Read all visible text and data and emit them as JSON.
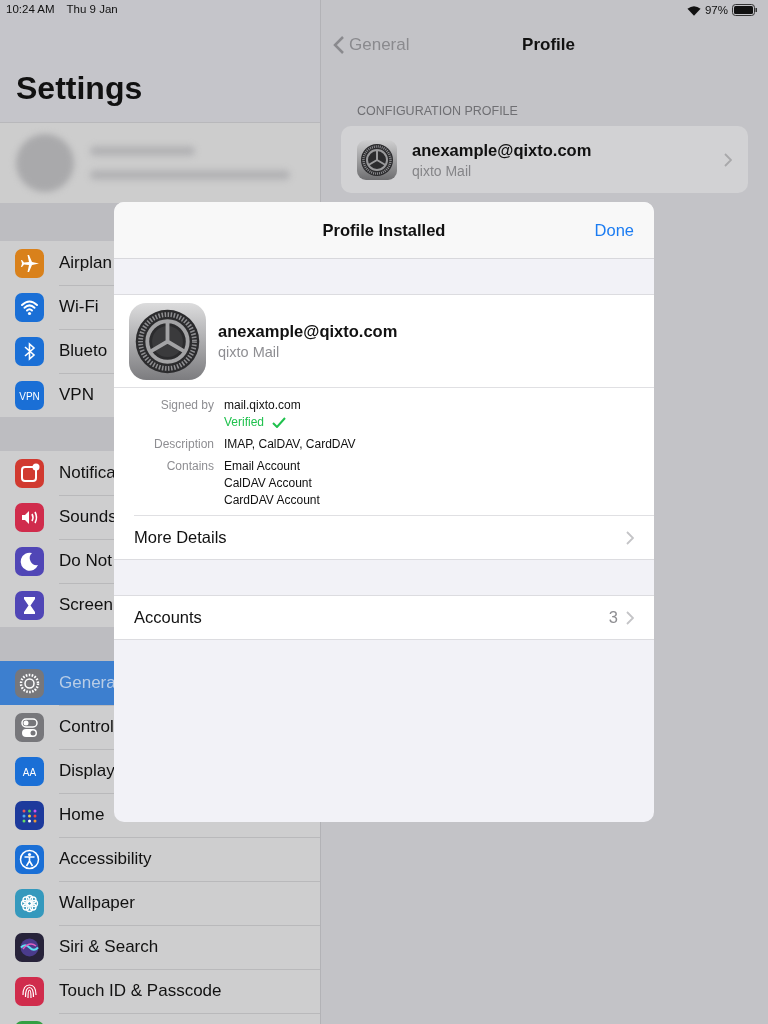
{
  "status_bar": {
    "time": "10:24 AM",
    "date": "Thu 9 Jan",
    "battery": "97%"
  },
  "sidebar": {
    "title": "Settings",
    "groups": [
      {
        "items": [
          {
            "label": "Airplan",
            "color": "#d9811b",
            "selected": false
          },
          {
            "label": "Wi-Fi",
            "color": "#1a6fd6",
            "selected": false
          },
          {
            "label": "Blueto",
            "color": "#1a6fd6",
            "selected": false
          },
          {
            "label": "VPN",
            "icon_text": "VPN",
            "color": "#1a6fd6",
            "selected": false
          }
        ]
      },
      {
        "items": [
          {
            "label": "Notifica",
            "color": "#d13a30",
            "selected": false
          },
          {
            "label": "Sounds",
            "color": "#d02c4c",
            "selected": false
          },
          {
            "label": "Do Not",
            "color": "#5046b6",
            "selected": false
          },
          {
            "label": "Screen",
            "color": "#5046b6",
            "selected": false
          }
        ]
      },
      {
        "items": [
          {
            "label": "Genera",
            "color": "#77777b",
            "selected": true
          },
          {
            "label": "Control",
            "color": "#77777b",
            "selected": false
          },
          {
            "label": "Display",
            "icon_text": "AA",
            "color": "#1a6fd6",
            "selected": false
          },
          {
            "label": "Home",
            "color": "#1d3a9c",
            "selected": false
          },
          {
            "label": "Accessibility",
            "color": "#1a6fd6",
            "selected": false
          },
          {
            "label": "Wallpaper",
            "color": "#3599bd",
            "selected": false
          },
          {
            "label": "Siri & Search",
            "color": "#27233a",
            "selected": false
          },
          {
            "label": "Touch ID & Passcode",
            "color": "#d02c4c",
            "selected": false
          },
          {
            "color": "#34a043",
            "selected": false
          }
        ]
      }
    ]
  },
  "detail": {
    "back": "General",
    "title": "Profile",
    "section": "CONFIGURATION PROFILE",
    "profile": {
      "name": "anexample@qixto.com",
      "org": "qixto Mail"
    }
  },
  "modal": {
    "title": "Profile Installed",
    "done": "Done",
    "profile": {
      "name": "anexample@qixto.com",
      "org": "qixto Mail"
    },
    "details": [
      {
        "label": "Signed by",
        "lines": [
          "mail.qixto.com"
        ],
        "verified": "Verified"
      },
      {
        "label": "Description",
        "lines": [
          "IMAP, CalDAV, CardDAV"
        ]
      },
      {
        "label": "Contains",
        "lines": [
          "Email Account",
          "CalDAV Account",
          "CardDAV Account"
        ]
      }
    ],
    "groups": [
      [
        {
          "label": "More Details"
        }
      ],
      [
        {
          "label": "Accounts",
          "value": "3"
        }
      ]
    ]
  }
}
